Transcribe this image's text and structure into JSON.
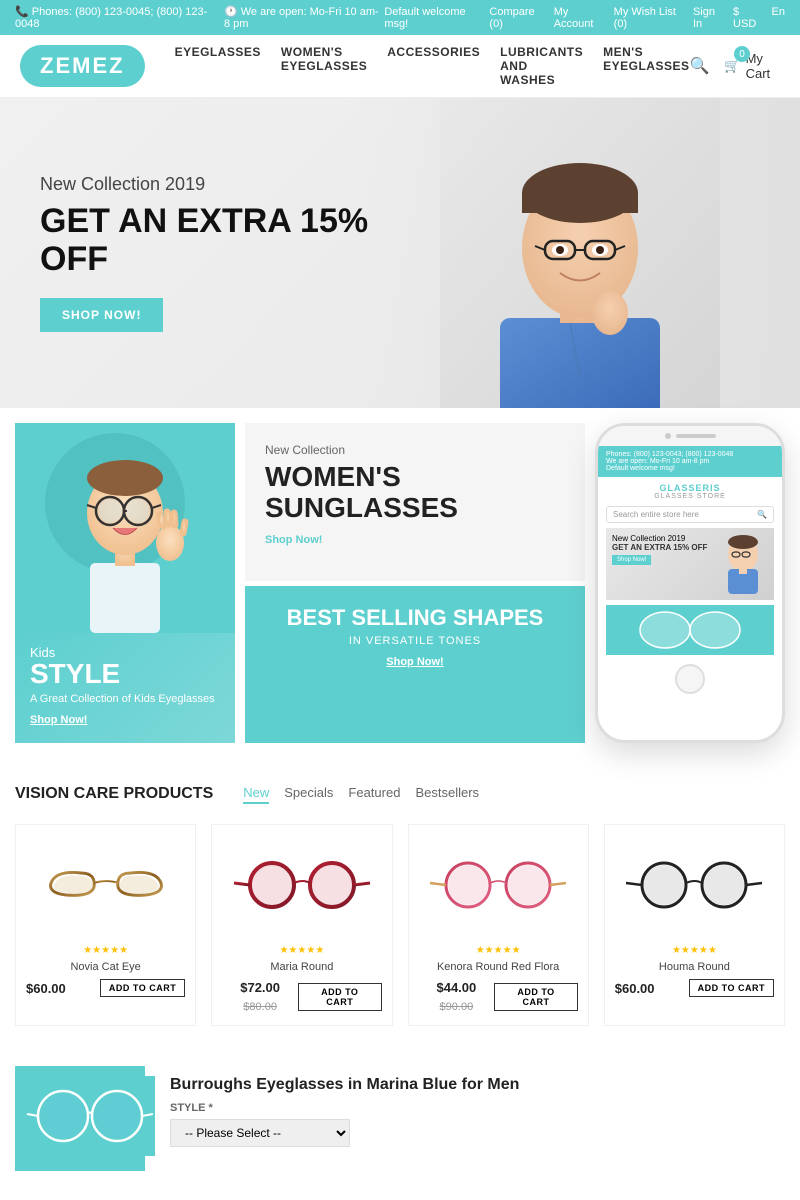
{
  "topbar": {
    "phones": "Phones: (800) 123-0045; (800) 123-0048",
    "hours": "We are open: Mo-Fri 10 am-8 pm",
    "welcome": "Default welcome msg!",
    "compare": "Compare (0)",
    "account": "My Account",
    "wishlist": "My Wish List (0)",
    "signin": "Sign In",
    "currency": "$ USD",
    "lang": "En"
  },
  "header": {
    "logo": "ZEMEZ",
    "nav": {
      "eyeglasses": "EYEGLASSES",
      "womens": "WOMEN'S EYEGLASSES",
      "accessories": "ACCESSORIES",
      "lubricants": "LUBRICANTS AND WASHES",
      "mens": "MEN'S EYEGLASSES"
    },
    "cart": "My Cart",
    "cart_count": "0"
  },
  "hero": {
    "subtitle": "New Collection 2019",
    "title": "GET AN EXTRA 15% OFF",
    "button": "Shop Now!"
  },
  "collections": {
    "kids": {
      "label": "Kids",
      "title": "STYLE",
      "subtitle": "A Great Collection of Kids Eyeglasses",
      "link": "Shop Now!"
    },
    "womens": {
      "label": "New Collection",
      "title": "WOMEN'S SUNGLASSES",
      "link": "Shop Now!"
    },
    "shapes": {
      "title": "BEST SELLING SHAPES",
      "subtitle": "IN VERSATILE TONES",
      "link": "Shop Now!"
    }
  },
  "phone": {
    "phones": "Phones: (800) 123-0043; (800) 123-0048",
    "hours": "We are open: Mo-Fri 10 am-8 pm",
    "welcome": "Default welcome msg!",
    "brand_name": "GLASSERIS",
    "brand_subtitle": "GLASSES STORE",
    "search_placeholder": "Search entire store here",
    "hero_subtitle": "New Collection 2019",
    "hero_title": "GET AN EXTRA 15% OFF",
    "hero_btn": "Shop Now!"
  },
  "products": {
    "section_title": "VISION CARE PRODUCTS",
    "tabs": [
      "New",
      "Specials",
      "Featured",
      "Bestsellers"
    ],
    "active_tab": "New",
    "items": [
      {
        "name": "Novia Cat Eye",
        "price": "$60.00",
        "old_price": "",
        "stars": "★★★★★",
        "color": "#c8a055"
      },
      {
        "name": "Maria Round",
        "price": "$72.00",
        "old_price": "$80.00",
        "stars": "★★★★★",
        "color": "#c03040"
      },
      {
        "name": "Kenora Round Red Flora",
        "price": "$44.00",
        "old_price": "$90.00",
        "stars": "★★★★★",
        "color": "#c04050"
      },
      {
        "name": "Houma Round",
        "price": "$60.00",
        "old_price": "",
        "stars": "★★★★★",
        "color": "#222222"
      }
    ],
    "add_to_cart": "ADD TO CART"
  },
  "bottom": {
    "product_title": "Burroughs Eyeglasses in Marina Blue for Men",
    "style_label": "STYLE *",
    "style_placeholder": "-- Please Select --"
  }
}
